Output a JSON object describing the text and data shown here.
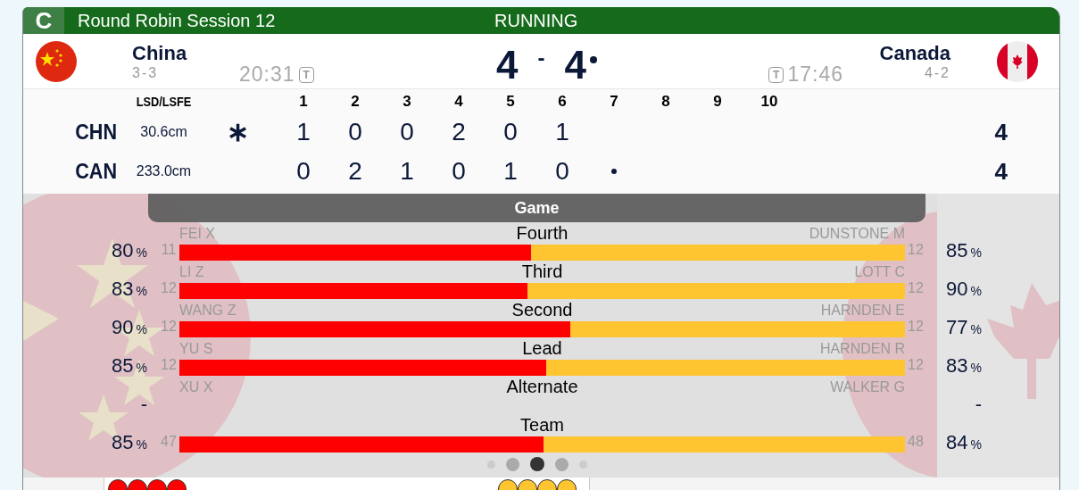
{
  "header": {
    "badge": "C",
    "title": "Round Robin Session 12",
    "status": "RUNNING"
  },
  "teams": [
    {
      "kind": "china",
      "name": "China",
      "record": "3-3",
      "clock": "20:31",
      "timeout": "T",
      "score": "4",
      "hammer": false
    },
    {
      "kind": "canada",
      "name": "Canada",
      "record": "4-2",
      "clock": "17:46",
      "timeout": "T",
      "score": "4",
      "hammer": true
    }
  ],
  "score_separator": "-",
  "linescore": {
    "lsd_label": "LSD/LSFE",
    "ends": [
      "1",
      "2",
      "3",
      "4",
      "5",
      "6",
      "7",
      "8",
      "9",
      "10"
    ],
    "rows": [
      {
        "abbr": "CHN",
        "lsd": "30.6cm",
        "first_hammer": true,
        "mark": "∗",
        "scores": [
          "1",
          "0",
          "0",
          "2",
          "0",
          "1"
        ],
        "hammer": false,
        "total": "4"
      },
      {
        "abbr": "CAN",
        "lsd": "233.0cm",
        "first_hammer": false,
        "scores": [
          "0",
          "2",
          "1",
          "0",
          "1",
          "0"
        ],
        "hammer": true,
        "total": "4"
      }
    ]
  },
  "stats": {
    "title": "Game",
    "rows": [
      {
        "kind": "bar",
        "position": "Fourth",
        "level": 0.485,
        "left": {
          "player": "FEI X",
          "shots": "11",
          "pct": "80",
          "unit": "%"
        },
        "right": {
          "player": "DUNSTONE M",
          "shots": "12",
          "pct": "85",
          "unit": "%"
        }
      },
      {
        "kind": "bar",
        "position": "Third",
        "level": 0.48,
        "left": {
          "player": "LI Z",
          "shots": "12",
          "pct": "83",
          "unit": "%"
        },
        "right": {
          "player": "LOTT C",
          "shots": "12",
          "pct": "90",
          "unit": "%"
        }
      },
      {
        "kind": "bar",
        "position": "Second",
        "level": 0.539,
        "left": {
          "player": "WANG Z",
          "shots": "12",
          "pct": "90",
          "unit": "%"
        },
        "right": {
          "player": "HARNDEN E",
          "shots": "12",
          "pct": "77",
          "unit": "%"
        }
      },
      {
        "kind": "bar",
        "position": "Lead",
        "level": 0.505,
        "left": {
          "player": "YU S",
          "shots": "12",
          "pct": "85",
          "unit": "%"
        },
        "right": {
          "player": "HARNDEN R",
          "shots": "12",
          "pct": "83",
          "unit": "%"
        }
      },
      {
        "kind": "none",
        "position": "Alternate",
        "left": {
          "player": "XU X",
          "pct": "-"
        },
        "right": {
          "player": "WALKER G",
          "pct": "-"
        }
      },
      {
        "kind": "bar",
        "position": "Team",
        "level": 0.502,
        "left": {
          "shots": "47",
          "pct": "85",
          "unit": "%"
        },
        "right": {
          "shots": "48",
          "pct": "84",
          "unit": "%"
        }
      }
    ]
  },
  "pager": [
    {
      "selected": false
    },
    {
      "selected": false
    },
    {
      "selected": true
    },
    {
      "selected": false
    },
    {
      "selected": false
    }
  ],
  "stones": [
    {
      "color": "#ff0000"
    },
    {
      "color": "#ff0000"
    },
    {
      "color": "#ff0000"
    },
    {
      "color": "#ff0000"
    },
    {
      "color": "#ffc531"
    },
    {
      "color": "#ffc531"
    },
    {
      "color": "#ffc531"
    },
    {
      "color": "#ffc531"
    }
  ]
}
